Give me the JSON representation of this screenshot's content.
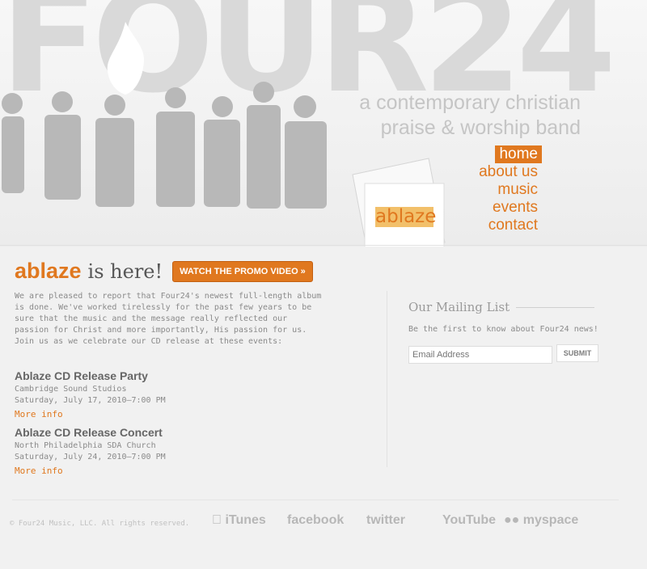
{
  "header": {
    "logo_text": "FOUR24",
    "tagline_line1": "a contemporary christian",
    "tagline_line2": "praise & worship band",
    "nav": [
      {
        "label": "home"
      },
      {
        "label": "about us"
      },
      {
        "label": "music"
      },
      {
        "label": "events"
      },
      {
        "label": "contact"
      }
    ],
    "cd_label": "ablaze"
  },
  "promo": {
    "brand": "ablaze",
    "rest": "is here!",
    "button": "WATCH THE PROMO VIDEO »"
  },
  "intro_text": "We are pleased to report that Four24's newest full-length album is done. We've worked tirelessly for the past few years to be sure that the music and the message really reflected our passion for Christ and more importantly, His passion for us. Join us as we celebrate our CD release at these events:",
  "events": [
    {
      "title": "Ablaze CD Release Party",
      "venue": "Cambridge Sound Studios",
      "date": "Saturday, July 17, 2010—7:00 PM",
      "link": "More info"
    },
    {
      "title": "Ablaze CD Release Concert",
      "venue": "North Philadelphia SDA Church",
      "date": "Saturday, July 24, 2010—7:00 PM",
      "link": "More info"
    }
  ],
  "mailing": {
    "title": "Our Mailing List",
    "text": "Be the first to know about Four24 news!",
    "placeholder": "Email Address",
    "submit": "SUBMIT"
  },
  "footer": {
    "copyright": "© Four24 Music, LLC. All rights reserved.",
    "links": [
      "iTunes",
      "facebook",
      "twitter",
      "YouTube",
      "myspace"
    ]
  }
}
